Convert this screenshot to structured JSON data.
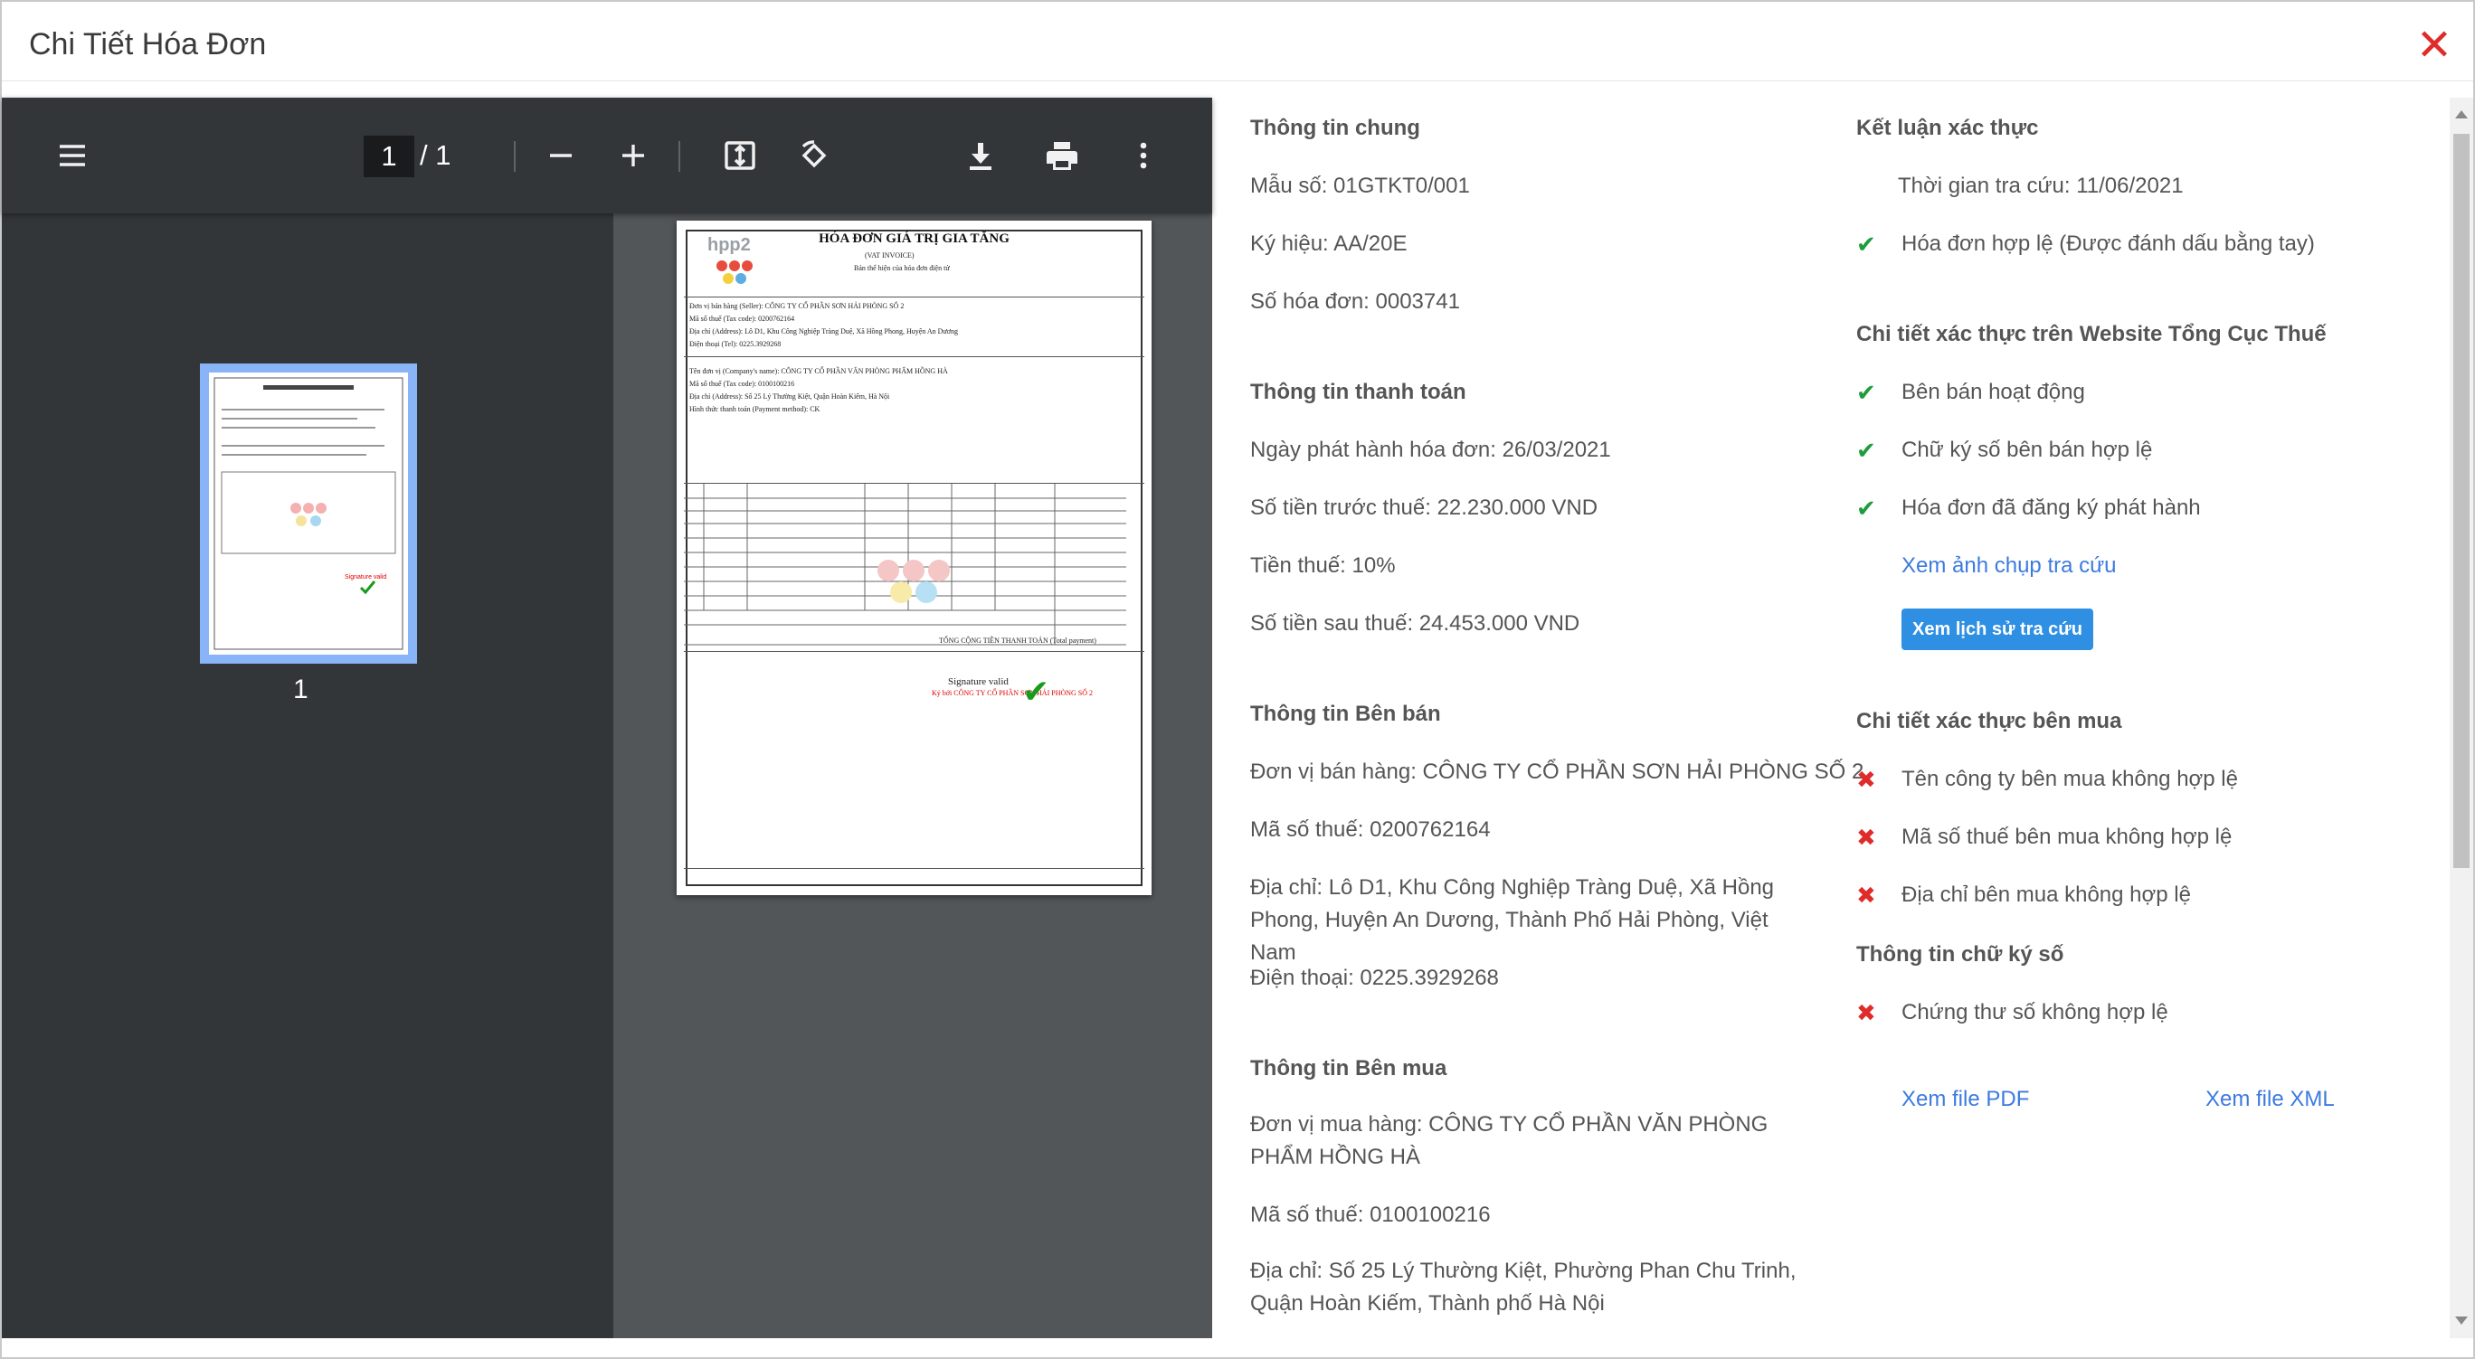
{
  "modal": {
    "title": "Chi Tiết Hóa Đơn",
    "close_symbol": "✕"
  },
  "viewer": {
    "current_page": "1",
    "page_separator": "/ 1",
    "thumbnail_label": "1",
    "icons": [
      "menu-icon",
      "zoom-out-icon",
      "zoom-in-icon",
      "fit-page-icon",
      "rotate-icon",
      "download-icon",
      "print-icon",
      "more-vert-icon"
    ]
  },
  "invoice_preview": {
    "logo": "hpp2",
    "title": "HÓA ĐƠN GIÁ TRỊ GIA TĂNG",
    "subtitle": "(VAT INVOICE)",
    "display_note": "Bản thể hiện của hóa đơn điện tử",
    "seller_line": "Đơn vị bán hàng (Seller): CÔNG TY CỔ PHẦN SƠN HẢI PHÒNG SỐ 2",
    "buyer_line": "Tên đơn vị (Company's name): CÔNG TY CỔ PHẦN VĂN PHÒNG PHẨM HỒNG HÀ",
    "total_line": "TỔNG CỘNG TIỀN THANH TOÁN (Total payment)",
    "signature_valid": "Signature valid",
    "signed_by": "Ký bởi CÔNG TY CỔ PHẦN SƠN HẢI PHÒNG SỐ 2"
  },
  "general": {
    "title": "Thông tin chung",
    "form_no": "Mẫu số: 01GTKT0/001",
    "symbol": "Ký hiệu: AA/20E",
    "invoice_no": "Số hóa đơn: 0003741"
  },
  "payment": {
    "title": "Thông tin thanh toán",
    "issue_date": "Ngày phát hành hóa đơn: 26/03/2021",
    "pre_tax": "Số tiền trước thuế: 22.230.000 VND",
    "tax": "Tiền thuế: 10%",
    "post_tax": "Số tiền sau thuế: 24.453.000 VND"
  },
  "seller": {
    "title": "Thông tin Bên bán",
    "name": "Đơn vị bán hàng: CÔNG TY CỔ PHẦN SƠN HẢI PHÒNG SỐ 2",
    "tax_code": "Mã số thuế: 0200762164",
    "address": "Địa chỉ: Lô D1, Khu Công Nghiệp Tràng Duệ, Xã Hồng Phong, Huyện An Dương, Thành Phố Hải Phòng, Việt Nam",
    "phone": "Điện thoại: 0225.3929268"
  },
  "buyer": {
    "title": "Thông tin Bên mua",
    "name": "Đơn vị mua hàng: CÔNG TY CỔ PHẦN VĂN PHÒNG PHẨM HỒNG HÀ",
    "tax_code": "Mã số thuế: 0100100216",
    "address": "Địa chỉ: Số 25 Lý Thường Kiệt, Phường Phan Chu Trinh, Quận Hoàn Kiếm, Thành phố Hà Nội"
  },
  "conclusion": {
    "title": "Kết luận xác thực",
    "lookup_time": "Thời gian tra cứu: 11/06/2021",
    "valid": "Hóa đơn hợp lệ (Được đánh dấu bằng tay)"
  },
  "tax_site": {
    "title": "Chi tiết xác thực trên Website Tổng Cục Thuế",
    "items": [
      "Bên bán hoạt động",
      "Chữ ký số bên bán hợp lệ",
      "Hóa đơn đã đăng ký phát hành"
    ],
    "link_capture": "Xem ảnh chụp tra cứu",
    "history_button": "Xem lịch sử tra cứu"
  },
  "buyer_check": {
    "title": "Chi tiết xác thực bên mua",
    "items": [
      "Tên công ty bên mua không hợp lệ",
      "Mã số thuế bên mua không hợp lệ",
      "Địa chỉ bên mua không hợp lệ"
    ]
  },
  "signature": {
    "title": "Thông tin chữ ký số",
    "item": "Chứng thư số không hợp lệ"
  },
  "files": {
    "pdf": "Xem file PDF",
    "xml": "Xem file XML"
  },
  "marks": {
    "ok": "✔",
    "bad": "✖"
  },
  "colors": {
    "ok": "#1f9c3c",
    "bad": "#e02b2b",
    "link": "#3c7ae0",
    "button": "#2e8fe3",
    "viewer_toolbar": "#323639"
  }
}
